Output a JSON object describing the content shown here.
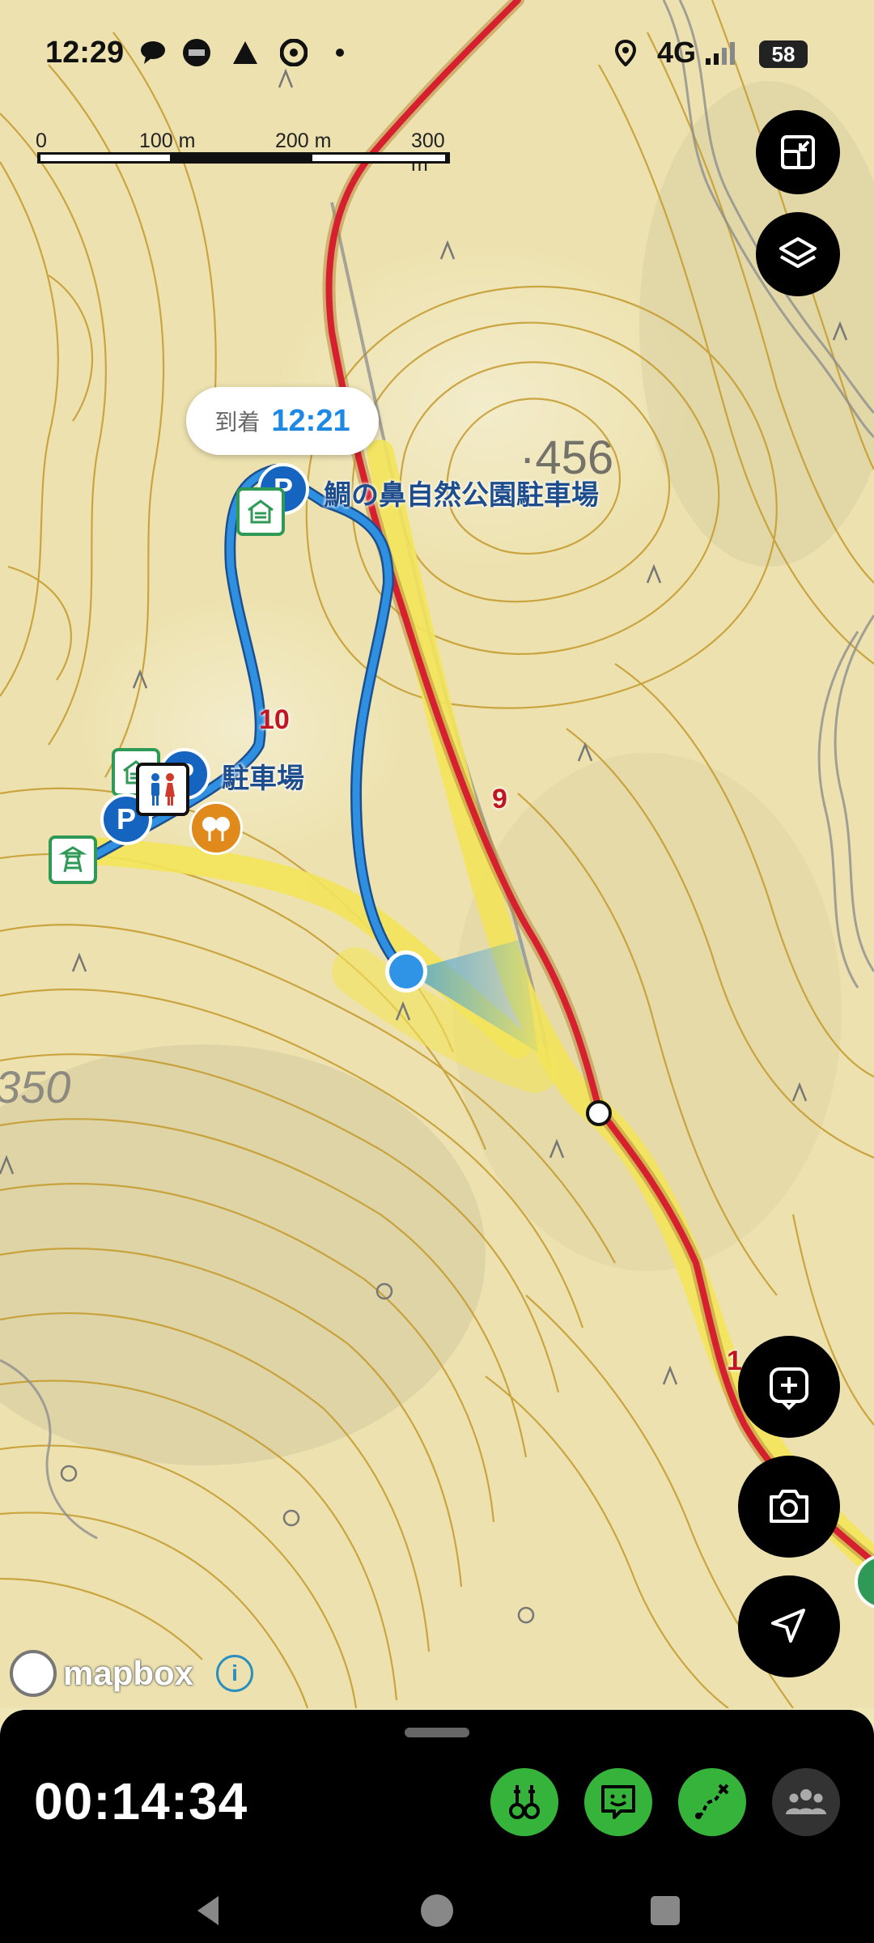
{
  "status_bar": {
    "time": "12:29",
    "network": "4G",
    "battery": "58",
    "icons": [
      "chat-bubble-icon",
      "zozotown-icon",
      "triangle-app-icon",
      "chrome-icon",
      "dot-icon",
      "location-icon",
      "signal-icon"
    ]
  },
  "map": {
    "scale": {
      "labels": [
        "0",
        "100 m",
        "200 m",
        "300 m"
      ]
    },
    "arrival": {
      "label": "到着",
      "time": "12:21"
    },
    "places": {
      "parking_main": "鯛の鼻自然公園駐車場",
      "parking_small": "駐車場"
    },
    "elevations": {
      "peak": "456",
      "contour": "350"
    },
    "route_markers": {
      "km10": "10",
      "km9": "9",
      "km11": "1"
    },
    "attribution": {
      "brand": "mapbox",
      "info": "i"
    },
    "colors": {
      "track": "#1e88e5",
      "planned_route": "#d6202f",
      "trail_highlight": "#f3e45a",
      "contour": "#c49a2c"
    },
    "buttons": [
      "fullscreen-toggle-button",
      "layers-button",
      "add-waypoint-button",
      "camera-button",
      "navigate-button"
    ]
  },
  "panel": {
    "elapsed_time": "00:14:34",
    "buttons": [
      "gps-poles-button",
      "emoji-chat-button",
      "route-share-button",
      "group-button"
    ],
    "accent": "#36b33a"
  },
  "nav": {
    "buttons": [
      "back-button",
      "home-button",
      "recents-button"
    ]
  }
}
